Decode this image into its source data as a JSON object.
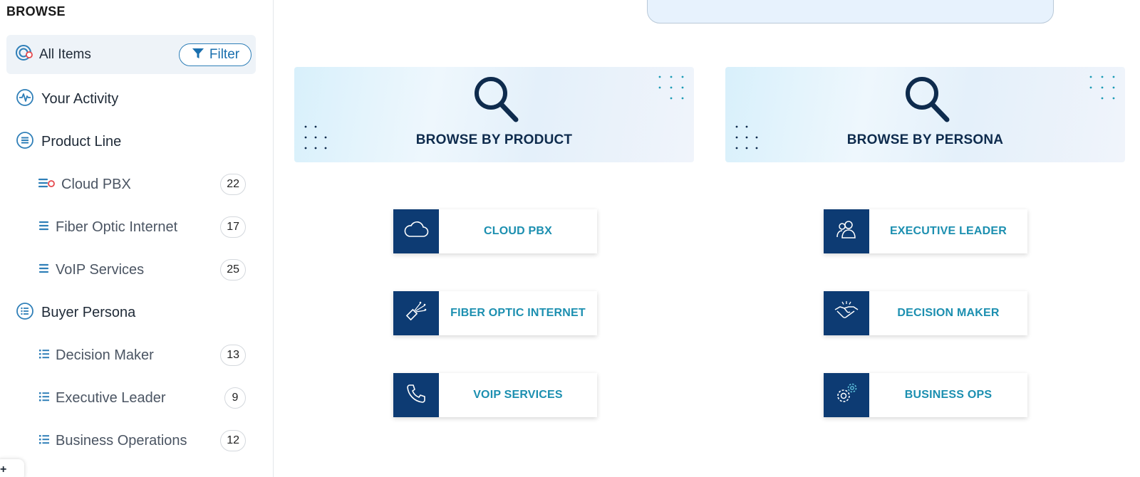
{
  "sidebar": {
    "title": "BROWSE",
    "all_items": {
      "label": "All Items",
      "icon": "all-items-icon"
    },
    "filter_label": "Filter",
    "your_activity": "Your Activity",
    "product_line": {
      "label": "Product Line",
      "items": [
        {
          "label": "Cloud PBX",
          "count": "22"
        },
        {
          "label": "Fiber Optic Internet",
          "count": "17"
        },
        {
          "label": "VoIP Services",
          "count": "25"
        }
      ]
    },
    "buyer_persona": {
      "label": "Buyer Persona",
      "items": [
        {
          "label": "Decision Maker",
          "count": "13"
        },
        {
          "label": "Executive Leader",
          "count": "9"
        },
        {
          "label": "Business Operations",
          "count": "12"
        }
      ]
    },
    "corner_glyph": "+"
  },
  "main": {
    "browse_product": {
      "title": "BROWSE BY PRODUCT",
      "cards": [
        {
          "label": "CLOUD PBX",
          "icon": "cloud-icon"
        },
        {
          "label": "FIBER OPTIC INTERNET",
          "icon": "fiber-optic-icon"
        },
        {
          "label": "VOIP SERVICES",
          "icon": "phone-icon"
        }
      ]
    },
    "browse_persona": {
      "title": "BROWSE BY PERSONA",
      "cards": [
        {
          "label": "EXECUTIVE LEADER",
          "icon": "users-icon"
        },
        {
          "label": "DECISION MAKER",
          "icon": "handshake-icon"
        },
        {
          "label": "BUSINESS OPS",
          "icon": "gears-icon"
        }
      ]
    }
  },
  "colors": {
    "accent": "#2f7fb8",
    "card_icon_bg": "#0d3b73",
    "card_text": "#1c8fb0",
    "banner_title": "#0e2b4d",
    "active_bg": "#eef3f8"
  }
}
